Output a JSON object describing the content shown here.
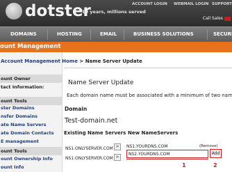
{
  "header": {
    "logo_text": "dotster",
    "tagline": "10 years, millions served",
    "top_links": [
      "ACCOUNT LOGIN",
      "WEBMAIL LOGIN",
      "SUPPORT"
    ],
    "call_sales": "Call Sales"
  },
  "nav": {
    "items": [
      "DOMAINS",
      "HOSTING",
      "EMAIL",
      "BUSINESS SOLUTIONS",
      "SECURI"
    ]
  },
  "title_bar": "ount Management",
  "sidebar": {
    "sections": [
      {
        "heading": "ount Owner",
        "items": [
          "tact Information:"
        ]
      },
      {
        "heading": "ount Tools",
        "items": [
          "ster Domains",
          "nsfer Domains",
          "ate Name Servers",
          "ate Domain Contacts",
          "E management"
        ]
      },
      {
        "heading": "ount Tools",
        "items": [
          "ount Ownership Info",
          "ount Info"
        ]
      }
    ]
  },
  "breadcrumb": {
    "link": "Account Management Home",
    "separator": " > ",
    "current": "Name Server Update"
  },
  "main": {
    "heading": "Name Server Update",
    "note": "Each domain name must be associated with a minimum of two name se",
    "domain_label": "Domain",
    "domain_name": "Test-domain.net",
    "col_existing": "Existing Name Servers",
    "col_new": "New NameServers",
    "existing_servers": [
      "NS1.ONLYSERVER.COM",
      "NS1.ONLYSERVER.COM"
    ],
    "arrow_label": ">",
    "new_servers": [
      "NS1.YOURDNS.COM"
    ],
    "remove_label": "(Remove)",
    "new_server_input": "NS2.YOURDNS.COM",
    "add_button": "Add",
    "markers": [
      "1",
      "2"
    ]
  },
  "colors": {
    "accent_orange": "#e8721c",
    "marker_red": "#cc2222",
    "link_blue": "#1f3f7a"
  }
}
